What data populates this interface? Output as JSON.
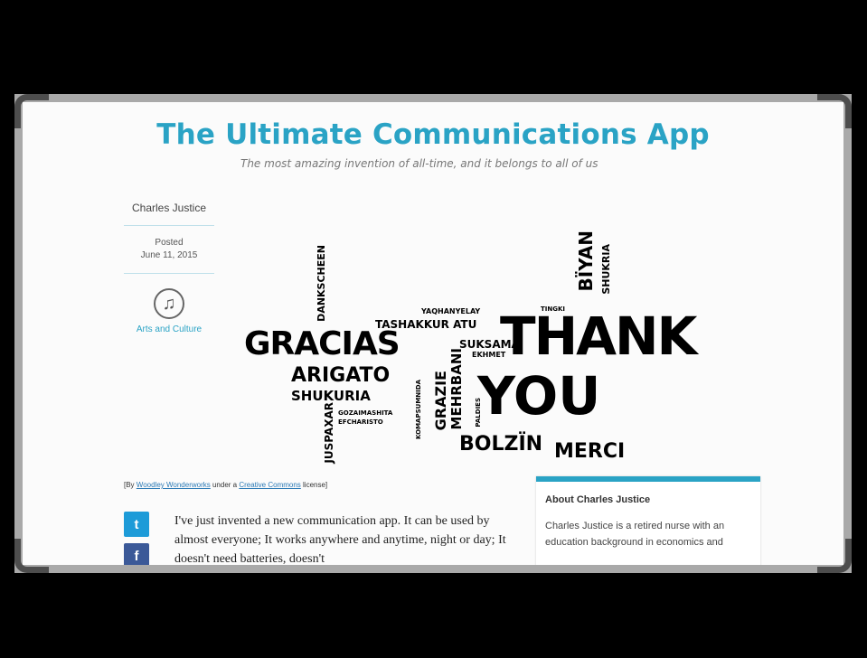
{
  "site": {
    "title": "The Ultimate Communications App",
    "tagline": "The most amazing invention of all-time, and it belongs to all of us"
  },
  "meta": {
    "author": "Charles Justice",
    "posted_label": "Posted",
    "posted_date": "June 11, 2015",
    "category_icon": "music-note-icon",
    "category": "Arts and Culture"
  },
  "cloud": {
    "thank": "THANK",
    "you": "YOU",
    "gracias": "GRACIAS",
    "arigato": "ARIGATO",
    "shukuria": "SHUKURIA",
    "bolzin": "BOLZÏN",
    "merci": "MERCI",
    "biyan": "BÏYAN",
    "shukria": "SHUKRIA",
    "dankscheen": "DANKSCHEEN",
    "tashakkur": "TASHAKKUR ATU",
    "yaqhanyelay": "YAQHANYELAY",
    "suksama": "SUKSAMA",
    "ekhmet": "EKHMET",
    "grazie": "GRAZIE",
    "mehrbani": "MEHRBANI",
    "juspaxar": "JUSPAXAR",
    "gozaimashita": "GOZAIMASHITA",
    "efcharisto": "EFCHARISTO",
    "tingki": "TINGKI",
    "komapsumnida": "KOMAPSUMNIDA",
    "paldies": "PALDIES"
  },
  "credit": {
    "prefix": "[By ",
    "author_link": "Woodley Wonderworks",
    "middle": " under a ",
    "license_link": "Creative Commons",
    "suffix": " license]"
  },
  "social": {
    "twitter_glyph": "t",
    "facebook_glyph": "f"
  },
  "article": {
    "text": "I've just invented a new communication app.  It can be used by almost everyone; It works anywhere and anytime, night or day;  It doesn't need batteries, doesn't"
  },
  "about": {
    "heading": "About Charles Justice",
    "text": "Charles Justice is a retired nurse with an education background in economics and"
  }
}
